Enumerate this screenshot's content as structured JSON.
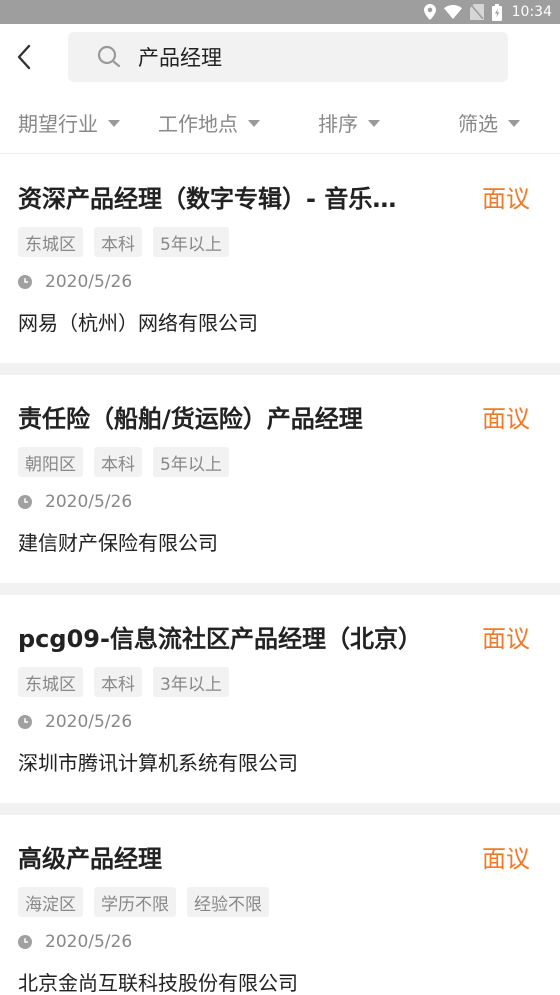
{
  "status_bar": {
    "time": "10:34"
  },
  "search": {
    "query": "产品经理"
  },
  "filters": [
    {
      "label": "期望行业"
    },
    {
      "label": "工作地点"
    },
    {
      "label": "排序"
    },
    {
      "label": "筛选"
    }
  ],
  "jobs": [
    {
      "title": "资深产品经理（数字专辑）- 音乐…",
      "salary": "面议",
      "tags": [
        "东城区",
        "本科",
        "5年以上"
      ],
      "date": "2020/5/26",
      "company": "网易（杭州）网络有限公司"
    },
    {
      "title": "责任险（船舶/货运险）产品经理",
      "salary": "面议",
      "tags": [
        "朝阳区",
        "本科",
        "5年以上"
      ],
      "date": "2020/5/26",
      "company": "建信财产保险有限公司"
    },
    {
      "title": "pcg09-信息流社区产品经理（北京）",
      "salary": "面议",
      "tags": [
        "东城区",
        "本科",
        "3年以上"
      ],
      "date": "2020/5/26",
      "company": "深圳市腾讯计算机系统有限公司"
    },
    {
      "title": "高级产品经理",
      "salary": "面议",
      "tags": [
        "海淀区",
        "学历不限",
        "经验不限"
      ],
      "date": "2020/5/26",
      "company": "北京金尚互联科技股份有限公司"
    }
  ],
  "colors": {
    "accent": "#f07a28",
    "status_bar": "#9e9e9e",
    "muted_text": "#888888",
    "tag_bg": "#f2f2f2"
  }
}
